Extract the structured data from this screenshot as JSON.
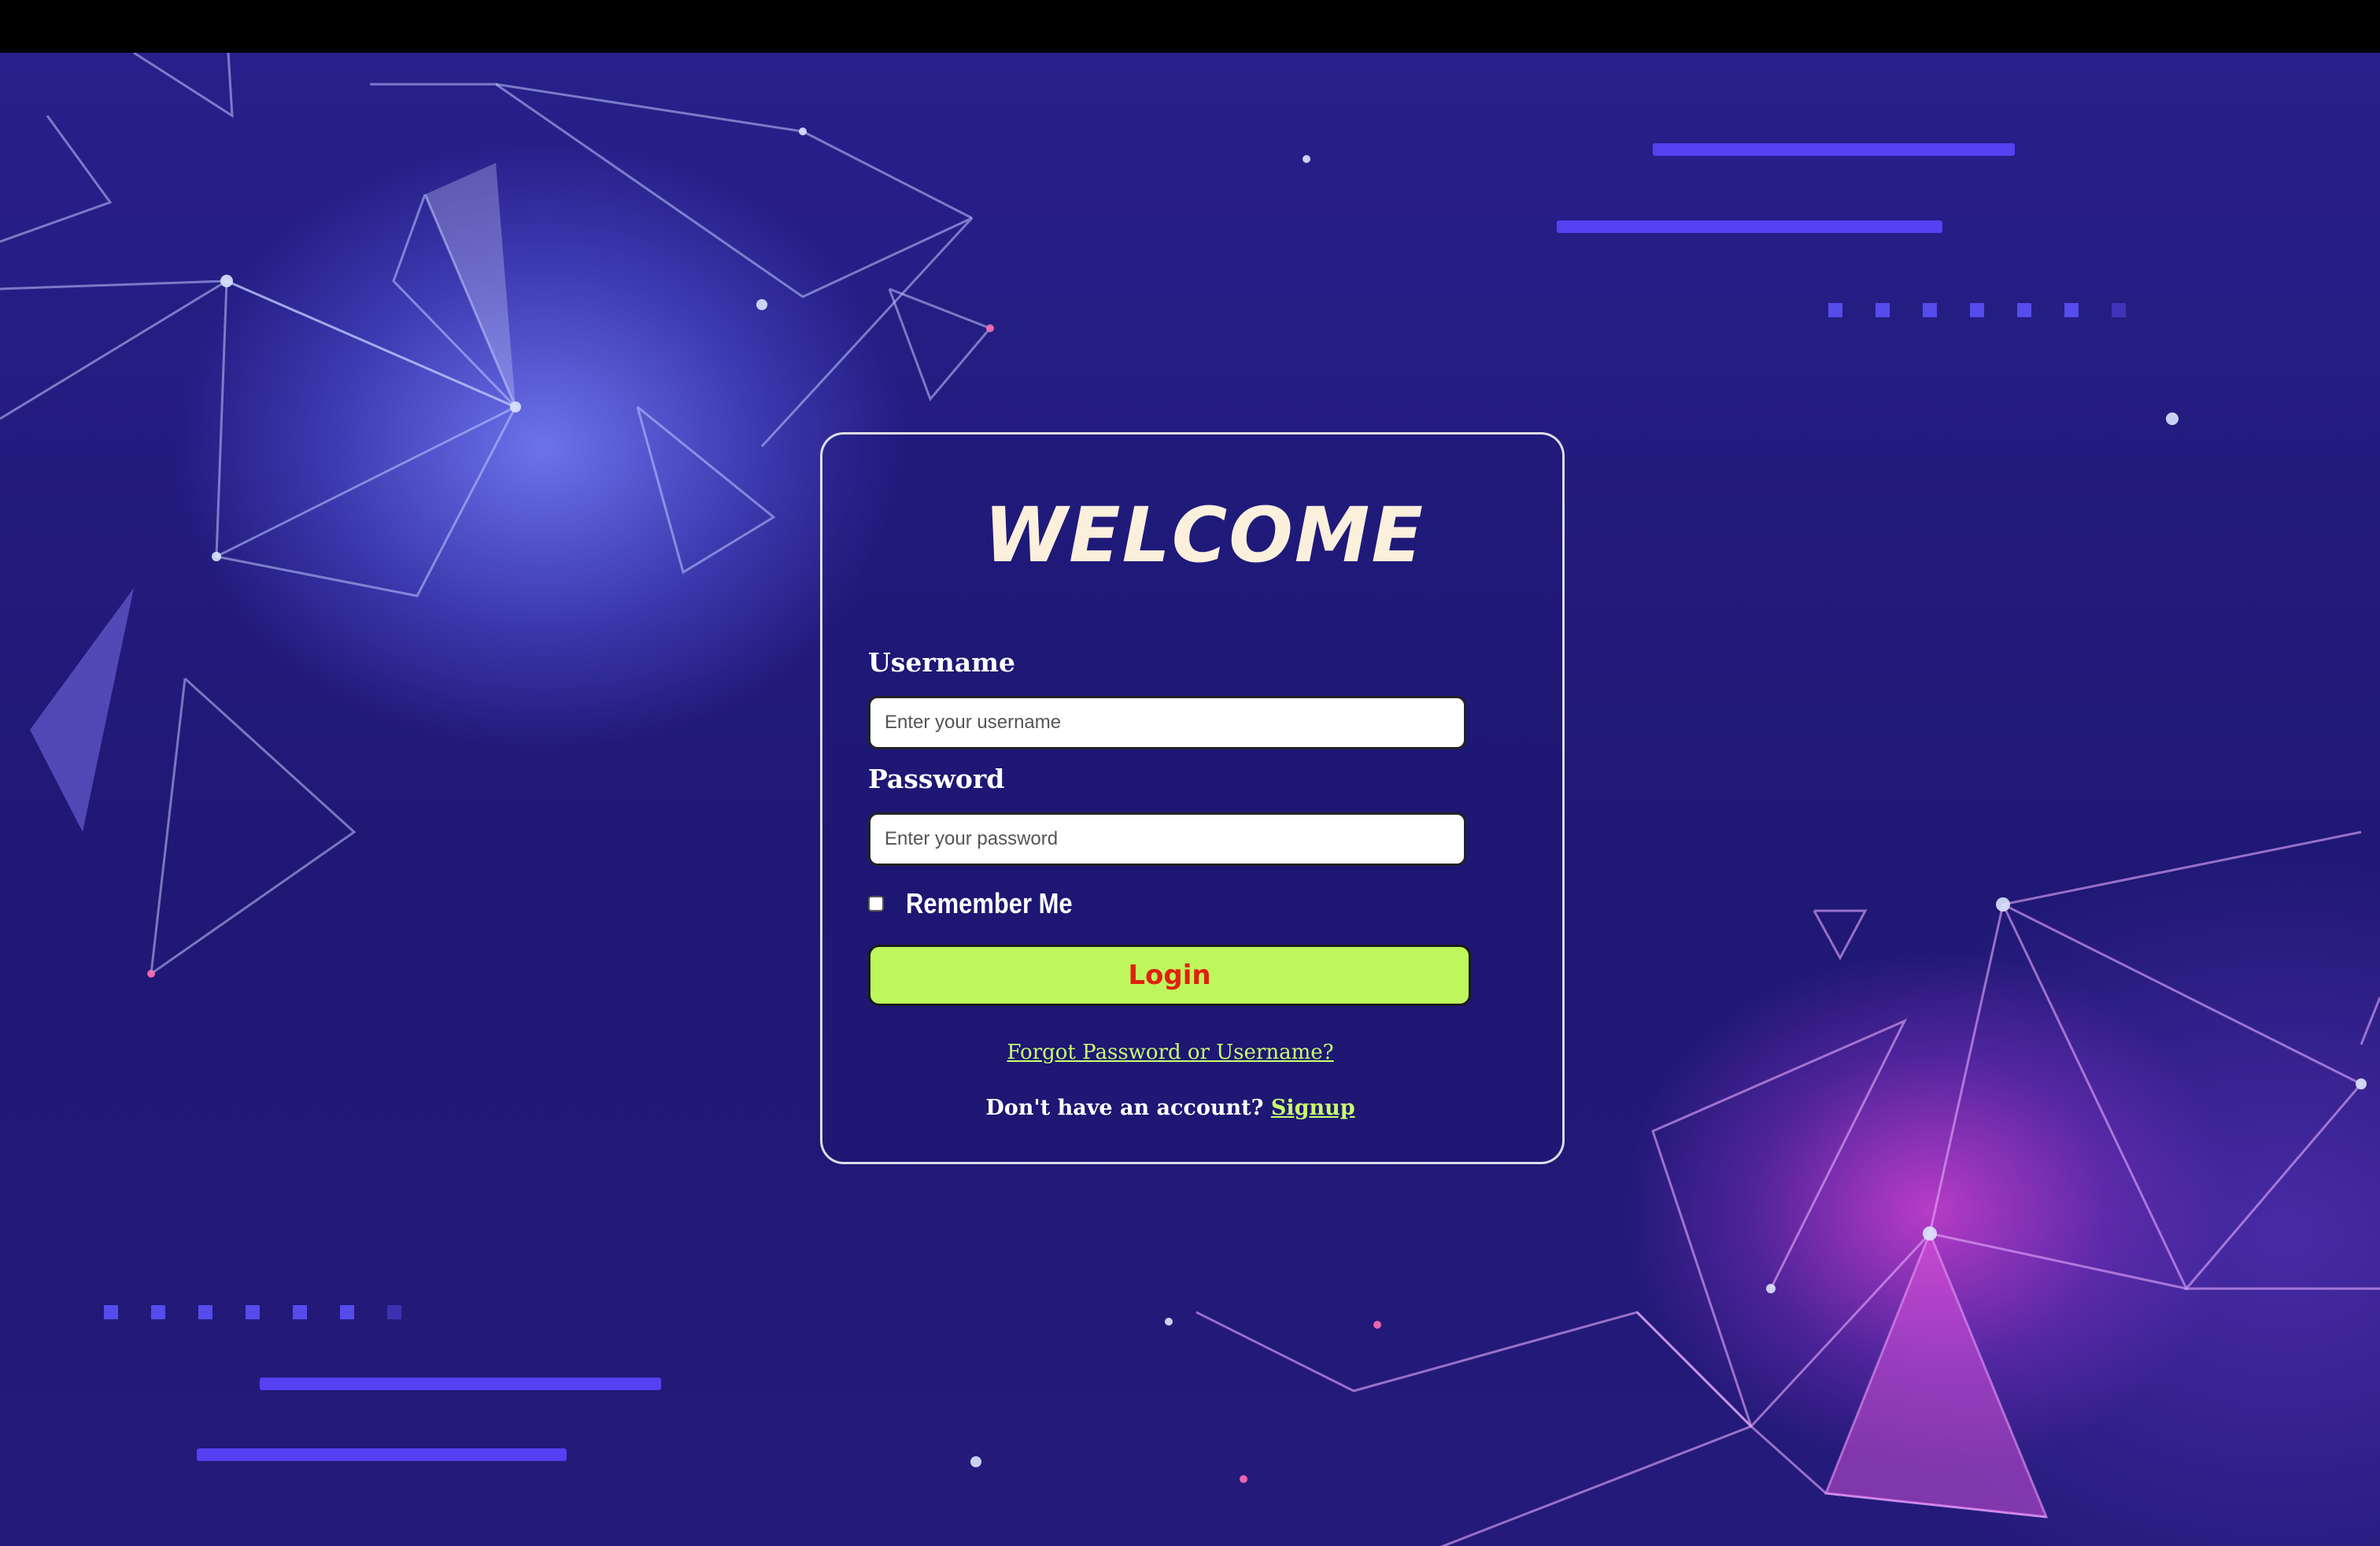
{
  "login_form": {
    "title": "WELCOME",
    "username_label": "Username",
    "username_placeholder": "Enter your username",
    "username_value": "",
    "password_label": "Password",
    "password_placeholder": "Enter your password",
    "password_value": "",
    "remember_label": "Remember Me",
    "remember_checked": false,
    "login_button_label": "Login",
    "forgot_link": "Forgot Password or Username?",
    "signup_prompt": "Don't have an account?",
    "signup_link": "Signup"
  },
  "colors": {
    "title_text": "#fbf0dc",
    "button_background": "#bdf75c",
    "button_text": "#e0200f",
    "link_text": "#c9ff6e",
    "background_primary": "#1f1874",
    "glow_left": "#7882ff",
    "glow_right": "#e046dc"
  }
}
